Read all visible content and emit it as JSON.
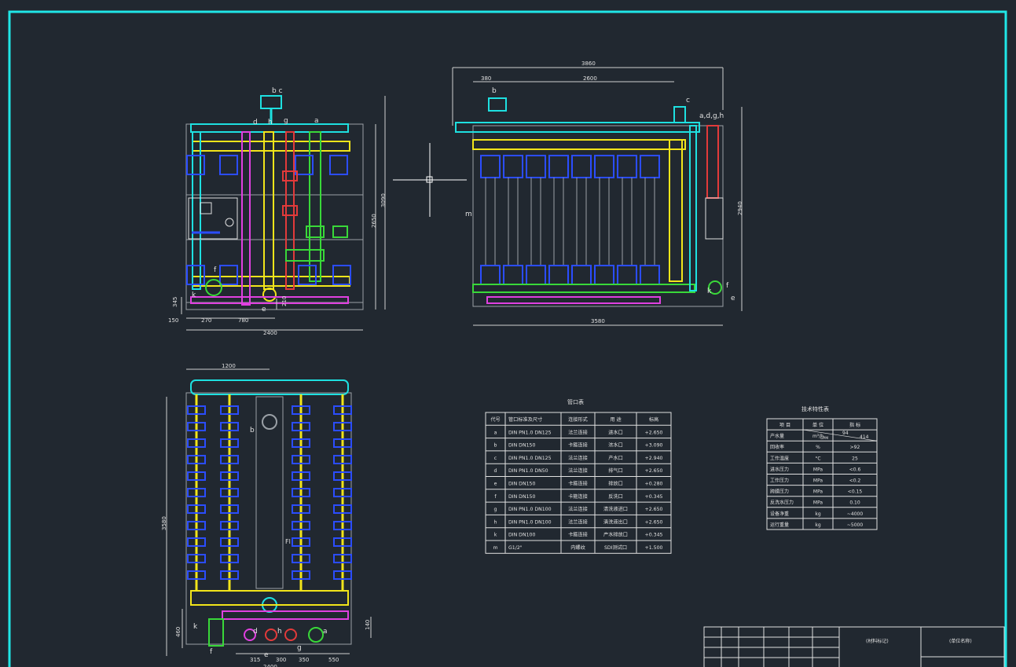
{
  "drawing": {
    "front_view": {
      "dims": {
        "width_total": "2400",
        "left_margin": "150",
        "offset_a": "270",
        "offset_b": "780",
        "bottom_h": "345",
        "small_h": "210",
        "height_inner": "2650",
        "height_total": "3090"
      },
      "labels": {
        "bc": "b c",
        "d": "d",
        "h": "h",
        "g": "g",
        "a": "a",
        "f": "f",
        "k": "k",
        "e": "e"
      }
    },
    "side_view": {
      "dims": {
        "top_total": "3860",
        "top_left": "380",
        "top_mid": "2600",
        "bottom_total": "3580",
        "height": "2940"
      },
      "labels": {
        "b": "b",
        "c": "c",
        "adgh": "a,d,g,h",
        "m": "m",
        "k": "k",
        "f": "f",
        "e": "e"
      }
    },
    "plan_view": {
      "dims": {
        "top_width": "1200",
        "left_height": "3580",
        "bottom_h": "460",
        "right_h": "140",
        "d1": "315",
        "d2": "300",
        "d3": "350",
        "d4": "550",
        "bottom_total": "2400"
      },
      "labels": {
        "b": "b",
        "k": "k",
        "f": "f",
        "d": "d",
        "h": "h",
        "g": "g",
        "e": "e",
        "a": "a",
        "fl": "Fl"
      }
    },
    "nozzle_table": {
      "title": "管口表",
      "headers": [
        "代号",
        "管口标准及尺寸",
        "连接形式",
        "用 途",
        "标高"
      ],
      "rows": [
        [
          "a",
          "DIN  PN1.0 DN125",
          "法兰连接",
          "进水口",
          "+2.650"
        ],
        [
          "b",
          "DIN  DN150",
          "卡箍连接",
          "浓水口",
          "+3.090"
        ],
        [
          "c",
          "DIN  PN1.0 DN125",
          "法兰连接",
          "产水口",
          "+2.940"
        ],
        [
          "d",
          "DIN  PN1.0 DN50",
          "法兰连接",
          "排气口",
          "+2.650"
        ],
        [
          "e",
          "DIN  DN150",
          "卡箍连接",
          "排放口",
          "+0.280"
        ],
        [
          "f",
          "DIN  DN150",
          "卡箍连接",
          "反洗口",
          "+0.345"
        ],
        [
          "g",
          "DIN  PN1.0 DN100",
          "法兰连接",
          "清洗液进口",
          "+2.650"
        ],
        [
          "h",
          "DIN  PN1.0 DN100",
          "法兰连接",
          "清洗液出口",
          "+2.650"
        ],
        [
          "k",
          "DIN  DN100",
          "卡箍连接",
          "产水排放口",
          "+0.345"
        ],
        [
          "m",
          "G1/2\"",
          "内螺纹",
          "SDI测试口",
          "+1.500"
        ]
      ]
    },
    "spec_table": {
      "title": "技术特性表",
      "headers": [
        "项 目",
        "单 位",
        "指 标"
      ],
      "rows": [
        [
          "产水量",
          "m³/h",
          "94",
          "414"
        ],
        [
          "回收率",
          "%",
          ">92"
        ],
        [
          "工作温度",
          "°C",
          "25"
        ],
        [
          "进水压力",
          "MPa",
          "<0.6"
        ],
        [
          "工作压力",
          "MPa",
          "<0.2"
        ],
        [
          "跨膜压力",
          "MPa",
          "<0.15"
        ],
        [
          "反洗水压力",
          "MPa",
          "0.10"
        ],
        [
          "设备净重",
          "kg",
          "~4000"
        ],
        [
          "运行重量",
          "kg",
          "~5000"
        ]
      ],
      "unit_gpm": "GPM"
    },
    "title_block": {
      "cell1": "(材料标记)",
      "cell2": "(单位名称)"
    }
  }
}
